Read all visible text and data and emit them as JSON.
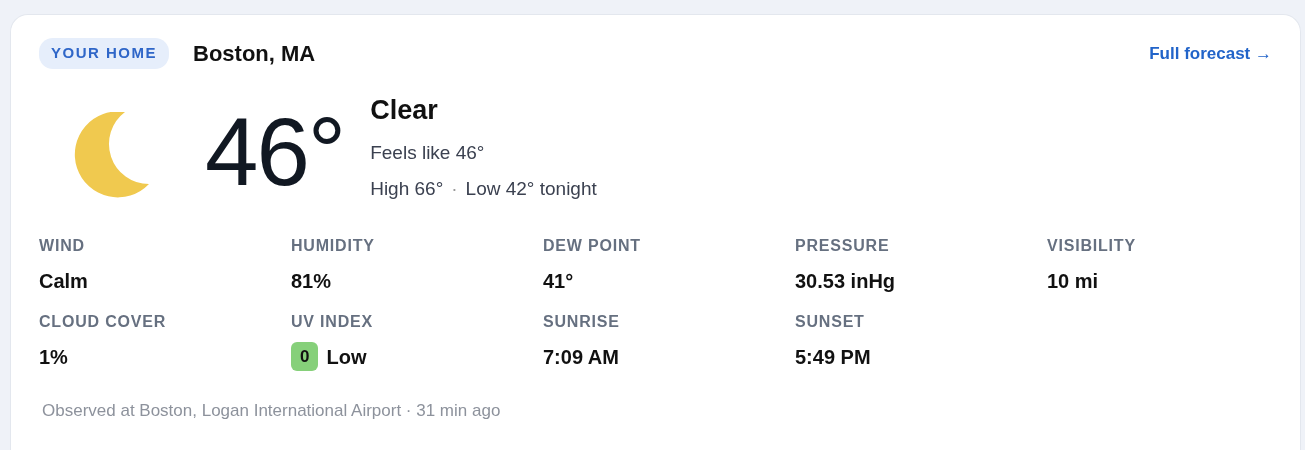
{
  "card": {
    "badge": "YOUR HOME",
    "location": "Boston, MA",
    "link": "Full forecast →"
  },
  "current": {
    "temperature": "46°",
    "condition": "Clear",
    "feels_like": "Feels like 46°",
    "high": "High 66°",
    "separator": "·",
    "low": "Low 42° tonight"
  },
  "stats": [
    {
      "kind": "text",
      "label": "WIND",
      "value": "Calm"
    },
    {
      "kind": "text",
      "label": "HUMIDITY",
      "value": "81%"
    },
    {
      "kind": "text",
      "label": "DEW POINT",
      "value": "41°"
    },
    {
      "kind": "text",
      "label": "PRESSURE",
      "value": "30.53 inHg"
    },
    {
      "kind": "text",
      "label": "VISIBILITY",
      "value": "10 mi"
    },
    {
      "kind": "text",
      "label": "CLOUD COVER",
      "value": "1%"
    },
    {
      "kind": "uv",
      "label": "UV INDEX",
      "index": "0",
      "value": "Low",
      "color": "#86d07a"
    },
    {
      "kind": "text",
      "label": "SUNRISE",
      "value": "7:09 AM"
    },
    {
      "kind": "text",
      "label": "SUNSET",
      "value": "5:49 PM"
    }
  ],
  "footer": "Observed at Boston, Logan International Airport · 31 min ago"
}
